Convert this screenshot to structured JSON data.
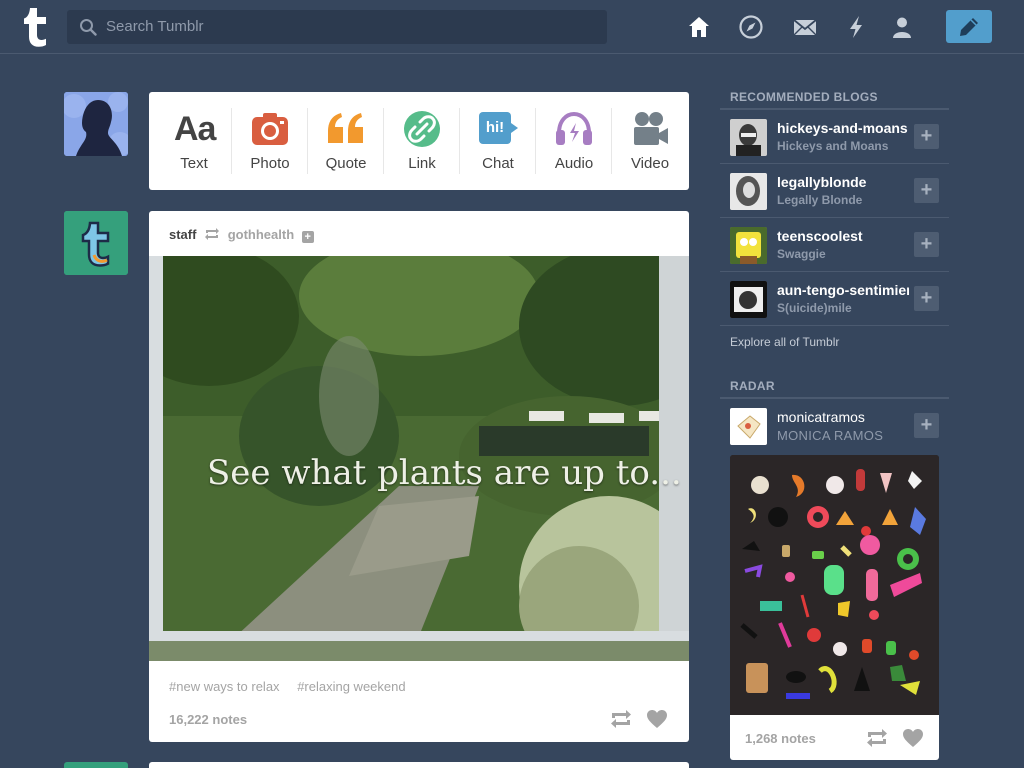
{
  "header": {
    "search_placeholder": "Search Tumblr",
    "nav_icons": [
      "home-icon",
      "explore-compass-icon",
      "messages-mail-icon",
      "activity-lightning-icon",
      "account-person-icon"
    ],
    "compose_icon": "pencil-icon",
    "colors": {
      "background": "#36465d",
      "compose": "#529ecc",
      "search_bg": "#2c3a4f"
    }
  },
  "post_types": [
    {
      "label": "Text",
      "glyph": "Aa",
      "icon": "text-aa-icon",
      "color": "#444444"
    },
    {
      "label": "Photo",
      "icon": "camera-icon",
      "color": "#d95e40"
    },
    {
      "label": "Quote",
      "glyph": "“",
      "icon": "quote-icon",
      "color": "#f2992e"
    },
    {
      "label": "Link",
      "icon": "chain-link-icon",
      "color": "#56bc8a"
    },
    {
      "label": "Chat",
      "glyph": "hi!",
      "icon": "chat-bubble-icon",
      "color": "#529ecc"
    },
    {
      "label": "Audio",
      "icon": "headphones-icon",
      "color": "#a77dc2"
    },
    {
      "label": "Video",
      "icon": "video-camera-icon",
      "color": "#748089"
    }
  ],
  "post": {
    "author": "staff",
    "reblog_icon": "reblog-icon",
    "source": "gothhealth",
    "follow_icon": "plus-icon",
    "image_caption": "See what plants are up to...",
    "tags": [
      "#new ways to relax",
      "#relaxing weekend"
    ],
    "notes": "16,222 notes",
    "actions": [
      "reblog-icon",
      "heart-icon"
    ]
  },
  "sidebar": {
    "recommended_heading": "RECOMMENDED BLOGS",
    "recommended": [
      {
        "name": "hickeys-and-moans",
        "title": "Hickeys and Moans"
      },
      {
        "name": "legallyblonde",
        "title": "Legally Blonde"
      },
      {
        "name": "teenscoolest",
        "title": "Swaggie"
      },
      {
        "name": "aun-tengo-sentimientos",
        "title": "S(uicide)mile"
      }
    ],
    "add_label": "+",
    "explore_link": "Explore all of Tumblr",
    "radar_heading": "RADAR",
    "radar": {
      "name": "monicatramos",
      "title": "MONICA RAMOS",
      "notes": "1,268 notes",
      "actions": [
        "reblog-icon",
        "heart-icon"
      ]
    }
  }
}
